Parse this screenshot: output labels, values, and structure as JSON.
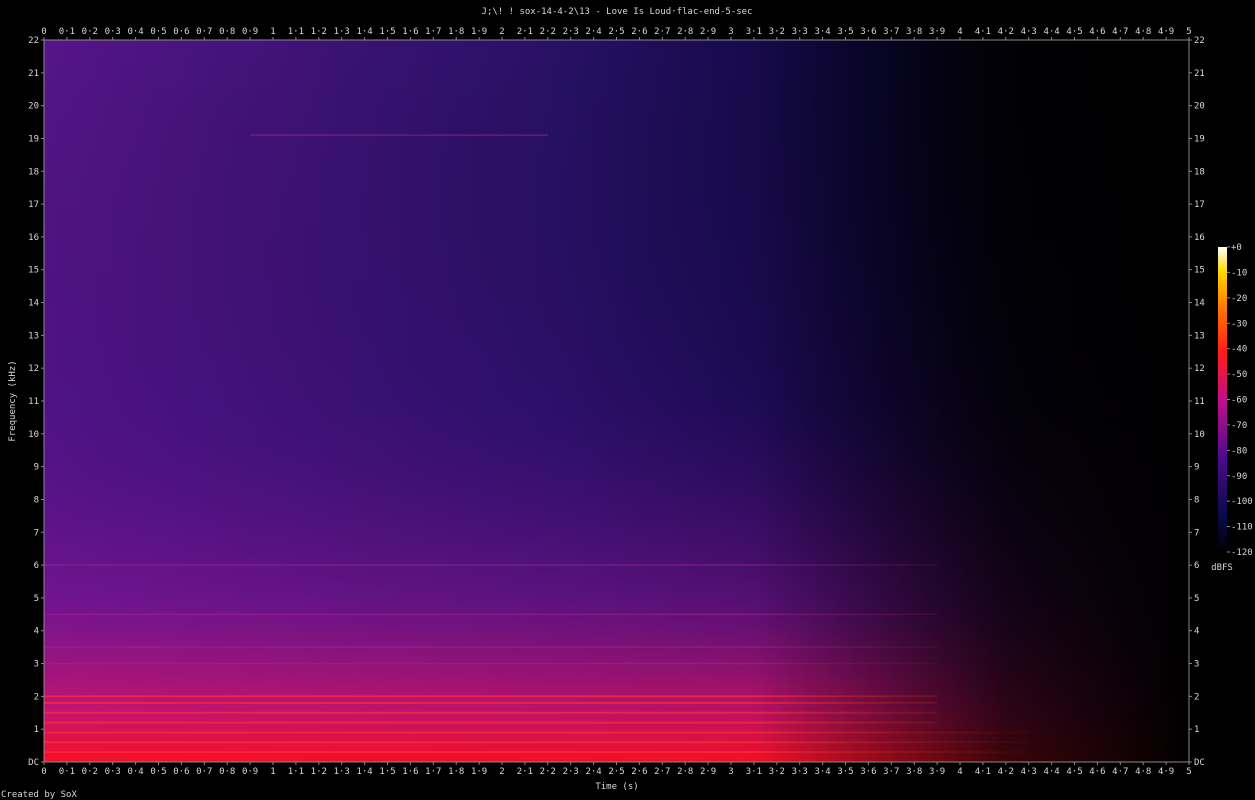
{
  "chart_data": {
    "type": "heatmap",
    "title": "J;\\! ! sox-14-4-2\\13 - Love Is Loud·flac-end-5-sec",
    "xlabel": "Time (s)",
    "ylabel": "Frequency (kHz)",
    "xlim": [
      0,
      5
    ],
    "ylim": [
      0,
      22
    ],
    "x_ticks": [
      "0",
      "0·1",
      "0·2",
      "0·3",
      "0·4",
      "0·5",
      "0·6",
      "0·7",
      "0·8",
      "0·9",
      "1",
      "1·1",
      "1·2",
      "1·3",
      "1·4",
      "1·5",
      "1·6",
      "1·7",
      "1·8",
      "1·9",
      "2",
      "2·1",
      "2·2",
      "2·3",
      "2·4",
      "2·5",
      "2·6",
      "2·7",
      "2·8",
      "2·9",
      "3",
      "3·1",
      "3·2",
      "3·3",
      "3·4",
      "3·5",
      "3·6",
      "3·7",
      "3·8",
      "3·9",
      "4",
      "4·1",
      "4·2",
      "4·3",
      "4·4",
      "4·5",
      "4·6",
      "4·7",
      "4·8",
      "4·9",
      "5"
    ],
    "y_ticks": [
      "DC",
      "1",
      "2",
      "3",
      "4",
      "5",
      "6",
      "7",
      "8",
      "9",
      "10",
      "11",
      "12",
      "13",
      "14",
      "15",
      "16",
      "17",
      "18",
      "19",
      "20",
      "21",
      "22"
    ],
    "colorbar": {
      "label": "dBFS",
      "ticks": [
        "+0",
        "-10",
        "-20",
        "-30",
        "-40",
        "-50",
        "-60",
        "-70",
        "-80",
        "-90",
        "-100",
        "-110",
        "-120"
      ],
      "range": [
        -120,
        0
      ]
    },
    "harmonics_khz": [
      0.3,
      0.6,
      0.9,
      1.2,
      1.5,
      1.8,
      2.0,
      3.0,
      3.5,
      4.5,
      6.0,
      19.1
    ],
    "grid": false,
    "footer": "Created by SoX"
  }
}
